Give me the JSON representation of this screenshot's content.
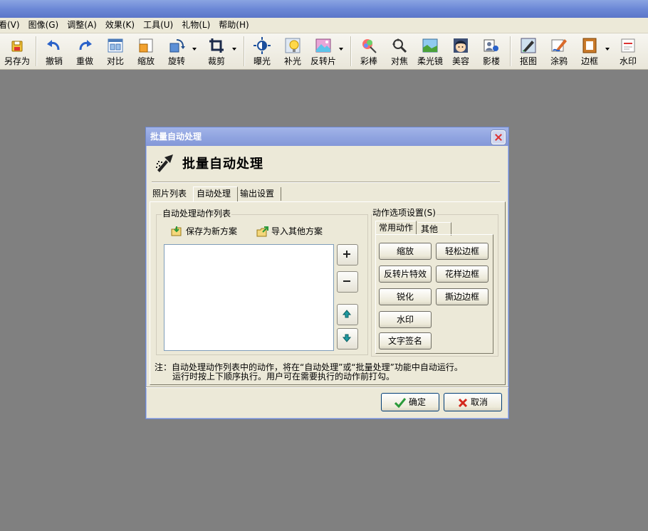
{
  "menu": [
    "看(V)",
    "图像(G)",
    "调整(A)",
    "效果(K)",
    "工具(U)",
    "礼物(L)",
    "帮助(H)"
  ],
  "toolbar": {
    "save_as": "另存为",
    "undo": "撤销",
    "redo": "重做",
    "compare": "对比",
    "resize": "缩放",
    "rotate": "旋转",
    "crop": "裁剪",
    "exposure": "曝光",
    "fill_light": "补光",
    "invert": "反转片",
    "color_pen": "彩棒",
    "focus": "对焦",
    "soft_lens": "柔光镜",
    "beauty": "美容",
    "shadow": "影楼",
    "cutout": "抠图",
    "graffiti": "涂鸦",
    "border": "边框",
    "watermark": "水印"
  },
  "dialog": {
    "title": "批量自动处理",
    "header": "批量自动处理",
    "tabs": [
      "照片列表",
      "自动处理",
      "输出设置"
    ],
    "left_group": {
      "title": "自动处理动作列表",
      "save_plan": "保存为新方案",
      "import_plan": "导入其他方案"
    },
    "right_group": {
      "title": "动作选项设置(S)",
      "tabs": [
        "常用动作",
        "其他"
      ],
      "actions": {
        "resize": "缩放",
        "easy_border": "轻松边框",
        "invert_effect": "反转片特效",
        "fancy_border": "花样边框",
        "sharpen": "锐化",
        "torn_border": "撕边边框",
        "watermark": "水印",
        "text_signature": "文字签名"
      }
    },
    "note_line1": "注：自动处理动作列表中的动作，将在“自动处理”或“批量处理”功能中自动运行。",
    "note_line2": "运行时按上下顺序执行。用户可在需要执行的动作前打勾。",
    "ok": "确定",
    "cancel": "取消"
  }
}
